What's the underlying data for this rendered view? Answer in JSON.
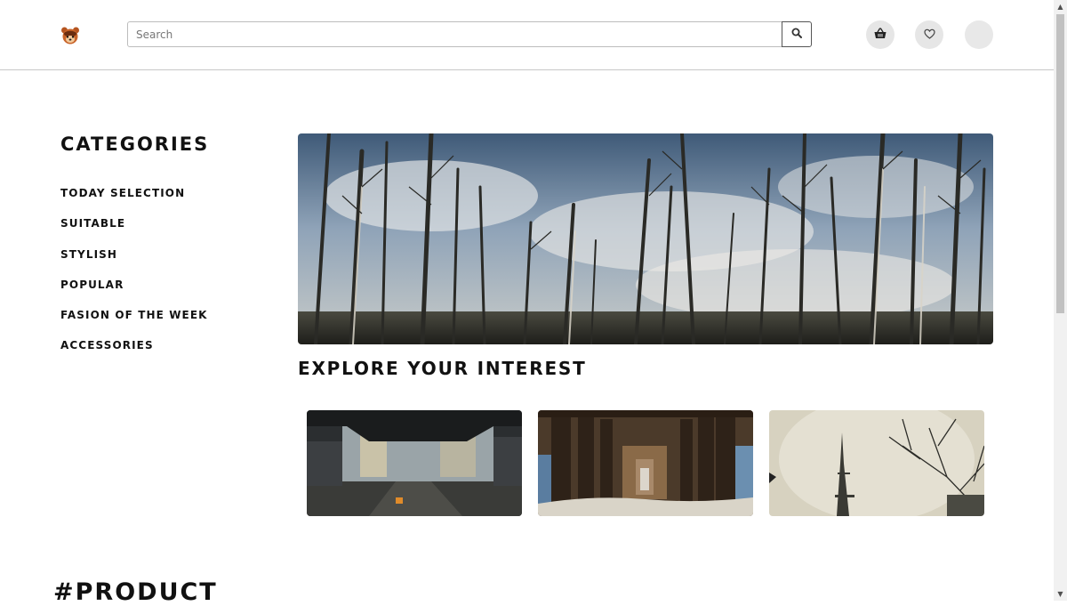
{
  "header": {
    "search": {
      "placeholder": "Search"
    },
    "icons": {
      "logo": "bear-logo-icon",
      "search": "search-icon",
      "cart": "basket-icon",
      "wishlist": "heart-icon",
      "avatar": "avatar"
    }
  },
  "sidebar": {
    "title": "CATEGORIES",
    "items": [
      {
        "label": "TODAY SELECTION"
      },
      {
        "label": "SUITABLE"
      },
      {
        "label": "STYLISH"
      },
      {
        "label": "POPULAR"
      },
      {
        "label": "FASION OF THE WEEK"
      },
      {
        "label": "ACCESSORIES"
      }
    ]
  },
  "main": {
    "banner": {
      "image": "dead-forest-sky-photo"
    },
    "explore_title": "EXPLORE YOUR INTEREST",
    "cards": [
      {
        "image": "underpass-city-photo"
      },
      {
        "image": "pier-underside-photo"
      },
      {
        "image": "eiffel-tower-fog-photo"
      }
    ],
    "product_title": "#PRODUCT"
  },
  "colors": {
    "text": "#111111",
    "header_border": "#c8c8c8",
    "icon_circle": "#e6e6e6",
    "scroll_thumb": "#c1c1c1"
  }
}
